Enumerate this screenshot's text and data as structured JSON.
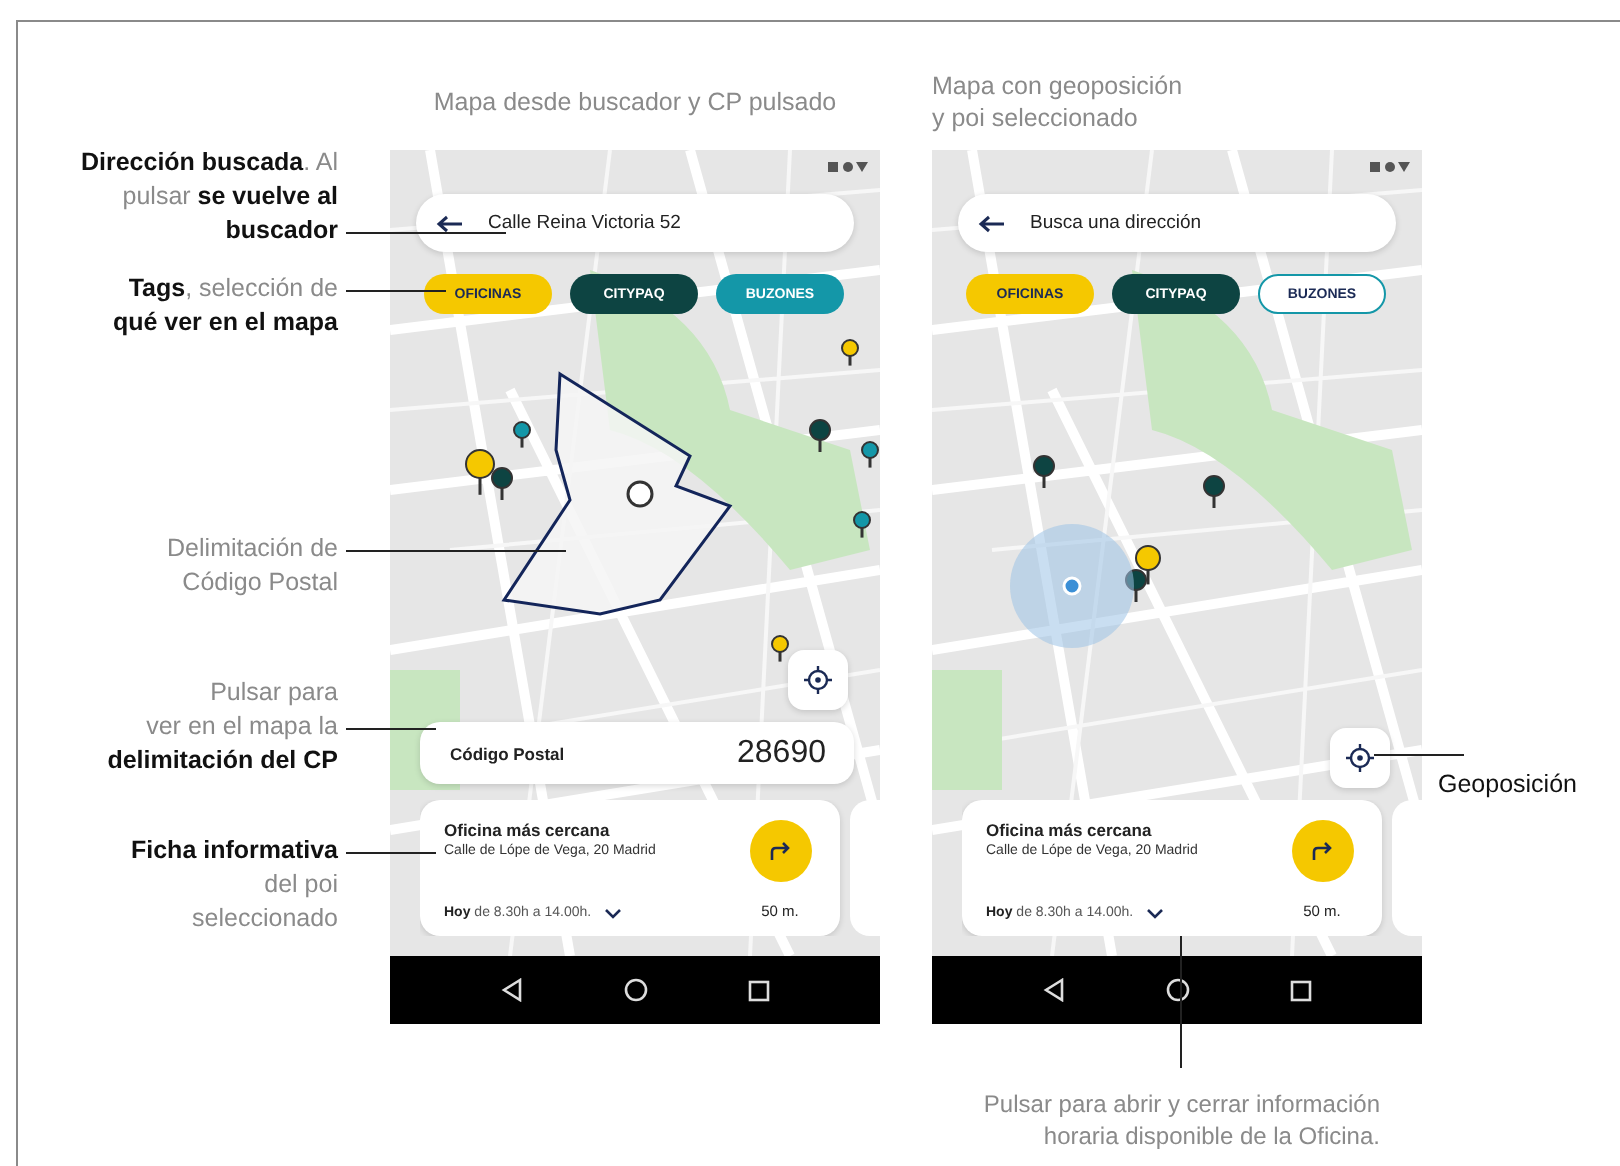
{
  "annotations_left": [
    {
      "lines": [
        "**Dirección buscada**. Al",
        "pulsar **se vuelve al**",
        "**buscador**"
      ]
    },
    {
      "lines": [
        "**Tags**, selección de",
        "**qué ver en el mapa**"
      ]
    },
    {
      "lines": [
        "Delimitación de",
        "Código Postal"
      ]
    },
    {
      "lines": [
        "Pulsar para",
        "ver en el mapa la",
        "**delimitación del CP**"
      ]
    },
    {
      "lines": [
        "**Ficha informativa**",
        "del poi",
        "seleccionado"
      ]
    }
  ],
  "screens": [
    {
      "caption": [
        "Mapa desde buscador y CP pulsado"
      ],
      "map": {
        "kind": "postal-area"
      },
      "search": {
        "value": "Calle Reina Victoria 52"
      },
      "tags": [
        {
          "label": "OFICINAS",
          "selected": true,
          "color": "#f5c800"
        },
        {
          "label": "CITYPAQ",
          "selected": true,
          "color": "#0d4442"
        },
        {
          "label": "BUZONES",
          "selected": true,
          "color": "#1497a8"
        }
      ],
      "postal_code": {
        "label": "Código Postal",
        "value": "28690"
      },
      "card": {
        "title": "Oficina más cercana",
        "address": "Calle de Lópe de Vega, 20 Madrid",
        "hours": "**Hoy** de 8.30h a 14.00h.",
        "expanded": false,
        "distance": "50 m."
      }
    },
    {
      "caption": [
        "Mapa con geoposición",
        "y poi seleccionado"
      ],
      "map": {
        "kind": "geolocation"
      },
      "search": {
        "placeholder": "Busca una dirección"
      },
      "tags": [
        {
          "label": "OFICINAS",
          "selected": true,
          "color": "#f5c800"
        },
        {
          "label": "CITYPAQ",
          "selected": true,
          "color": "#0d4442"
        },
        {
          "label": "BUZONES",
          "selected": false,
          "color": "#1497a8"
        }
      ],
      "card": {
        "title": "Oficina más cercana",
        "address": "Calle de Lópe de Vega, 20 Madrid",
        "hours": "**Hoy** de 8.30h a 14.00h.",
        "expanded": false,
        "distance": "50 m."
      }
    }
  ],
  "annotation_right": {
    "lines": [
      "Geoposición"
    ]
  },
  "annotation_bottom": {
    "lines": [
      "Pulsar para abrir y cerrar información",
      "horaria disponible de la Oficina."
    ]
  }
}
